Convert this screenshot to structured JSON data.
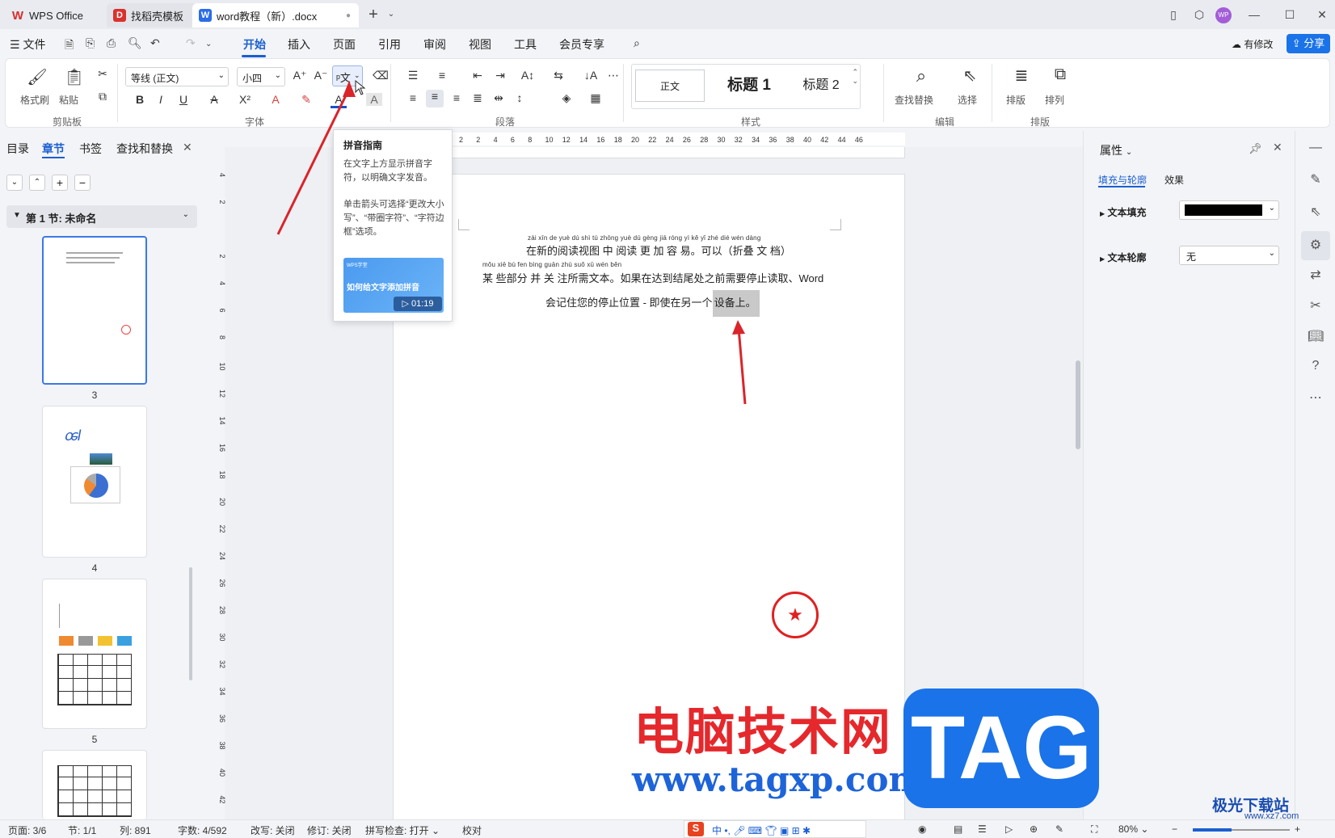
{
  "titlebar": {
    "tabs": [
      {
        "label": "WPS Office",
        "icon": "wps-logo-icon"
      },
      {
        "label": "找稻壳模板",
        "icon": "docer-icon"
      },
      {
        "label": "word教程（新）.docx",
        "icon": "word-doc-icon"
      }
    ],
    "avatar": "WP"
  },
  "menu": {
    "file": "文件",
    "items": [
      "开始",
      "插入",
      "页面",
      "引用",
      "审阅",
      "视图",
      "工具",
      "会员专享"
    ],
    "active": "开始",
    "changes_label": "有修改",
    "share_label": "分享"
  },
  "ribbon": {
    "format_painter": "格式刷",
    "paste": "粘贴",
    "clipboard_group": "剪贴板",
    "font_name": "等线 (正文)",
    "font_size": "小四",
    "font_group": "字体",
    "paragraph_group": "段落",
    "styles": [
      "正文",
      "标题 1",
      "标题 2"
    ],
    "styles_group": "样式",
    "find_replace": "查找替换",
    "select": "选择",
    "edit_group": "编辑",
    "layout": "排版",
    "arrange": "排列",
    "layout_group": "排版"
  },
  "left_panel": {
    "tabs": [
      "目录",
      "章节",
      "书签",
      "查找和替换"
    ],
    "active_tab": "章节",
    "section_label": "第 1 节: 未命名",
    "pages": [
      "3",
      "4",
      "5"
    ]
  },
  "tooltip": {
    "title": "拼音指南",
    "desc1": "在文字上方显示拼音字符，以明确文字发音。",
    "desc2": "单击箭头可选择“更改大小写”、“带圈字符”、“字符边框”选项。",
    "video_brand": "WPS学堂",
    "video_title": "如何给文字添加拼音",
    "video_time": "01:19"
  },
  "ruler": {
    "h_ticks": [
      "2",
      "2",
      "4",
      "6",
      "8",
      "10",
      "12",
      "14",
      "16",
      "18",
      "20",
      "22",
      "24",
      "26",
      "28",
      "30",
      "32",
      "34",
      "36",
      "38",
      "40",
      "42",
      "44",
      "46"
    ],
    "v_ticks": [
      "4",
      "2",
      "",
      "2",
      "4",
      "6",
      "8",
      "10",
      "12",
      "14",
      "16",
      "18",
      "20",
      "22",
      "24",
      "26",
      "28",
      "30",
      "32",
      "34",
      "36",
      "38",
      "40",
      "42"
    ]
  },
  "document": {
    "line1_ruby": "zài xīn de yuè dú shì tú zhōng yuè dú gèng jiā róng yì   kě yǐ    zhé dié wén dàng",
    "line1": "在新的阅读视图 中 阅读 更 加 容 易。可以（折叠 文 档）",
    "line2_ruby": "mǒu xiē  bù fen bìng guān zhù suǒ xū wén běn",
    "line2": "某 些部分 并  关 注所需文本。如果在达到结尾处之前需要停止读取、Word",
    "line3": "会记住您的停止位置 - 即使在另一个",
    "line3_selected": "设备上。"
  },
  "properties": {
    "title": "属性",
    "tabs": [
      "填充与轮廓",
      "效果"
    ],
    "fill_label": "文本填充",
    "fill_color": "#000000",
    "outline_label": "文本轮廓",
    "outline_value": "无"
  },
  "status": {
    "page": "页面: 3/6",
    "section": "节: 1/1",
    "column": "列: 891",
    "words": "字数: 4/592",
    "rewrite": "改写: 关闭",
    "revise": "修订: 关闭",
    "spell": "拼写检查: 打开",
    "proof": "校对",
    "zoom": "80%"
  },
  "watermarks": {
    "cn": "电脑技术网",
    "url": "www.tagxp.com",
    "tag": "TAG",
    "xz": "极光下载站",
    "xz_url": "www.xz7.com"
  },
  "colors": {
    "accent": "#1a73e8",
    "arrow": "#d9252a",
    "stamp": "#e02020"
  }
}
